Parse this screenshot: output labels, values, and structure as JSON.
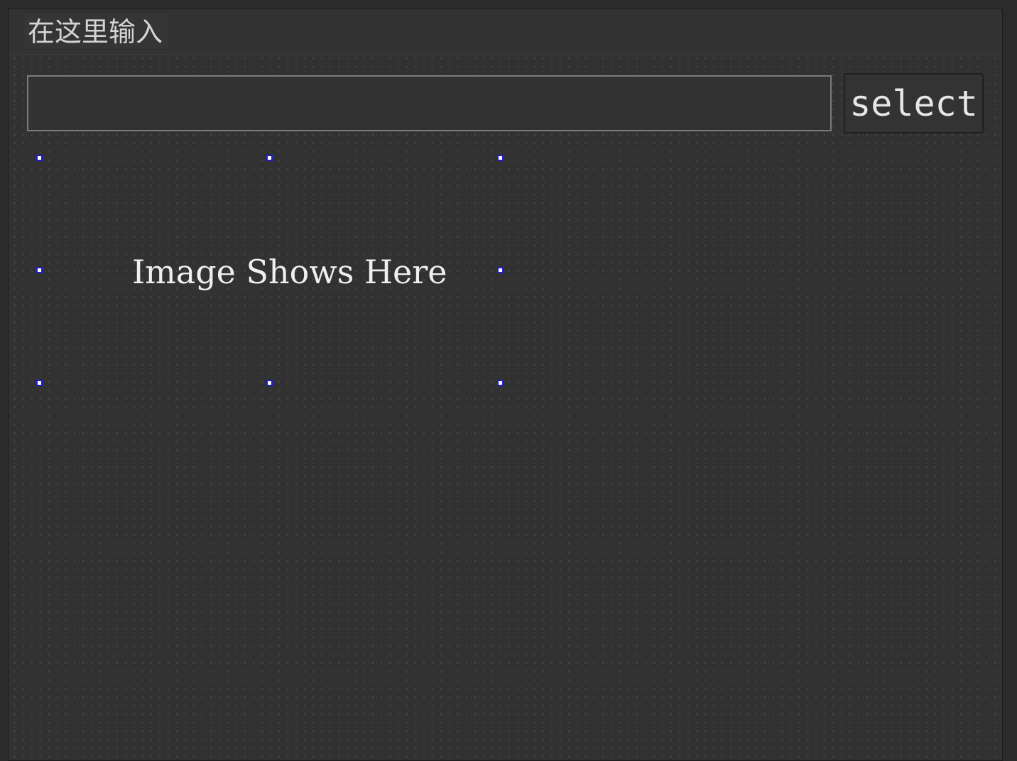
{
  "window": {
    "title": "在这里输入"
  },
  "path_input": {
    "value": "",
    "placeholder": ""
  },
  "select_button": {
    "label": "select"
  },
  "image_label": {
    "text": "Image Shows Here",
    "selected": true
  },
  "colors": {
    "background": "#323232",
    "grid_dot": "#4c4c4c",
    "text": "#efefef",
    "selection_handle_border": "#1f1fd0"
  }
}
